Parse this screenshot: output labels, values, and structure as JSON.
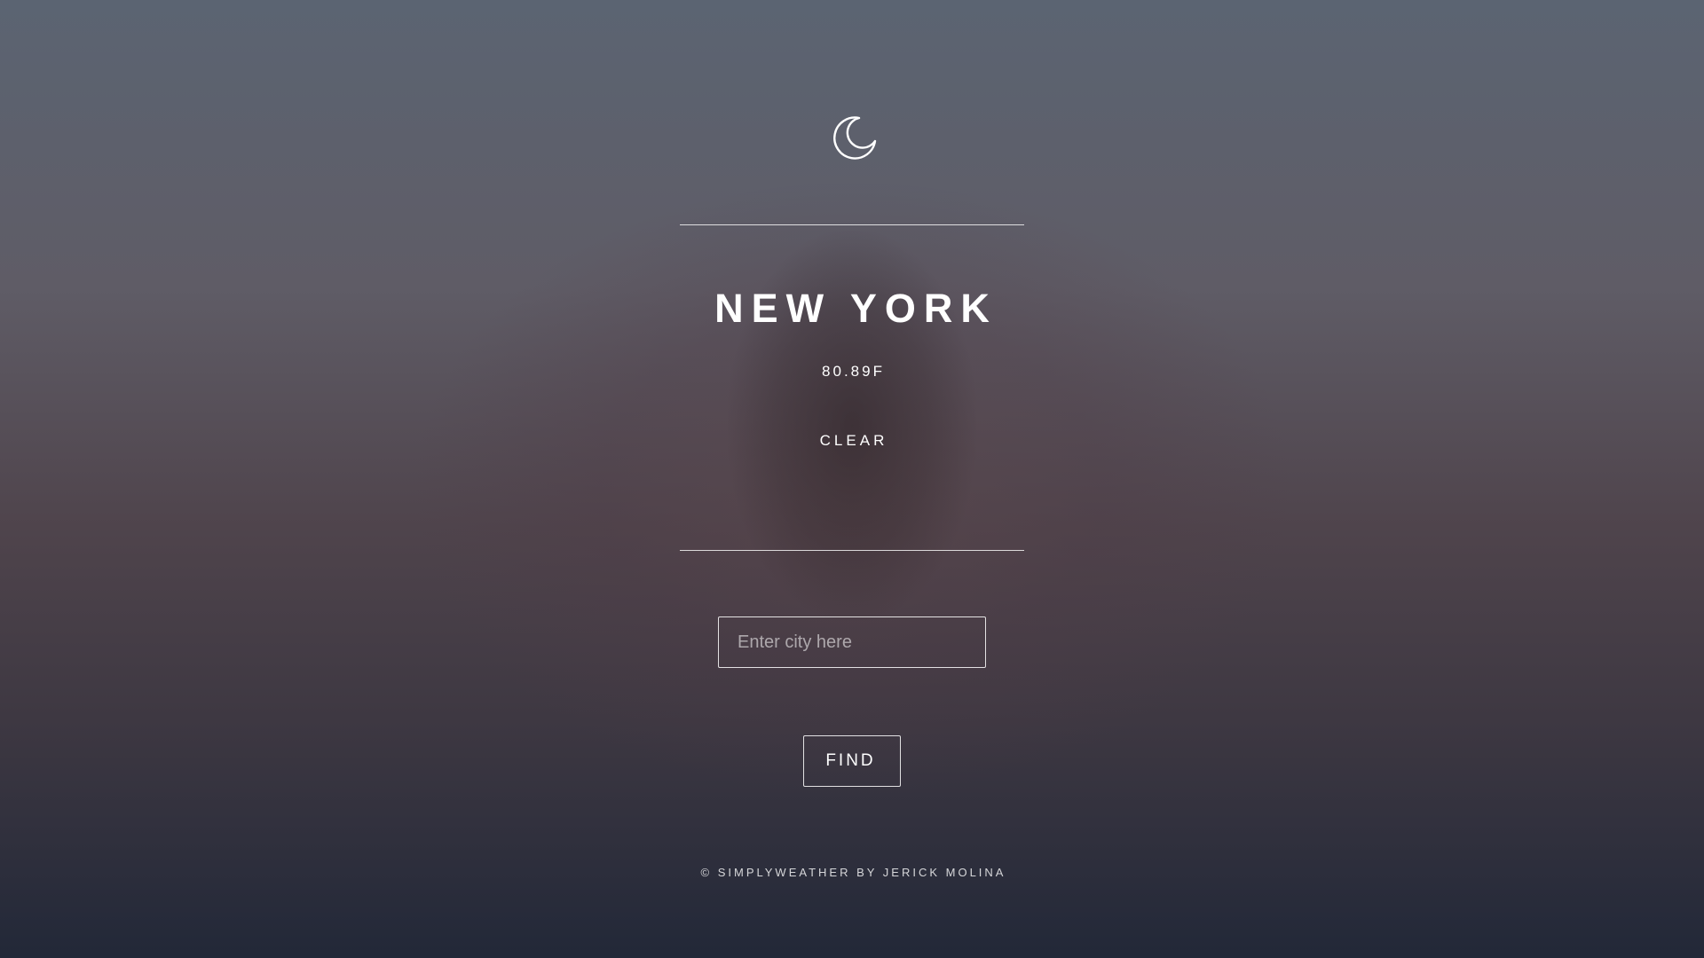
{
  "weather": {
    "icon": "moon-icon",
    "city": "NEW YORK",
    "temperature": "80.89F",
    "condition": "CLEAR"
  },
  "search": {
    "placeholder": "Enter city here",
    "value": "",
    "button_label": "FIND"
  },
  "footer": {
    "text": "© SIMPLYWEATHER BY JERICK MOLINA"
  },
  "colors": {
    "text": "#ffffff",
    "background_top": "#5b6472",
    "background_bottom": "#222838"
  }
}
